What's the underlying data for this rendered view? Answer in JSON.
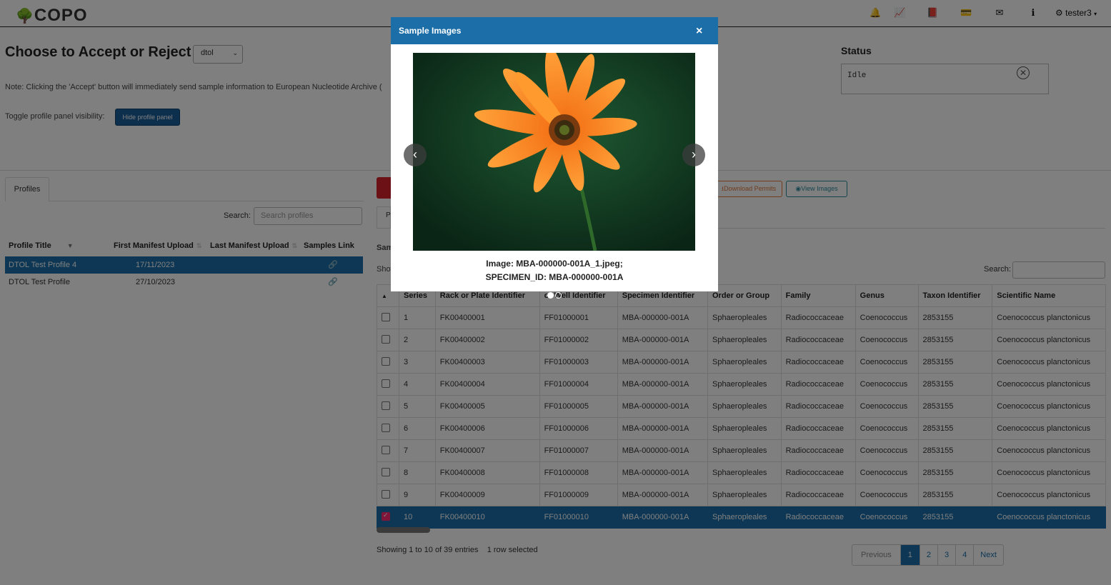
{
  "navbar": {
    "logo": "COPO",
    "icons": [
      "bell-icon",
      "chart-icon",
      "book-icon",
      "card-icon",
      "envelope-icon",
      "info-icon"
    ],
    "user": "tester3"
  },
  "header": {
    "title": "Choose to Accept or Reject",
    "group_select": "dtol",
    "note": "Note: Clicking the 'Accept' button will immediately send sample information to European Nucleotide Archive (",
    "toggle_label": "Toggle profile panel visibility:",
    "hide_button": "Hide profile panel"
  },
  "status": {
    "label": "Status",
    "value": "Idle"
  },
  "profiles": {
    "tab": "Profiles",
    "search_label": "Search:",
    "search_placeholder": "Search profiles",
    "columns": [
      "Profile Title",
      "First Manifest Upload",
      "Last Manifest Upload",
      "Samples Link"
    ],
    "rows": [
      {
        "title": "DTOL Test Profile 4",
        "first": "17/11/2023",
        "selected": true
      },
      {
        "title": "DTOL Test Profile",
        "first": "27/10/2023",
        "selected": false
      }
    ]
  },
  "samples": {
    "download_permits": "Download Permits",
    "view_images": "View Images",
    "tab_fragment": "P",
    "title_fragment": "Sam",
    "show_fragment": "Show",
    "search_label": "Search:",
    "columns": [
      "Series",
      "Rack or Plate Identifier",
      "or Well Identifier",
      "Specimen Identifier",
      "Order or Group",
      "Family",
      "Genus",
      "Taxon Identifier",
      "Scientific Name"
    ],
    "rows": [
      [
        "1",
        "FK00400001",
        "FF01000001",
        "MBA-000000-001A",
        "Sphaeropleales",
        "Radiococcaceae",
        "Coenococcus",
        "2853155",
        "Coenococcus planctonicus"
      ],
      [
        "2",
        "FK00400002",
        "FF01000002",
        "MBA-000000-001A",
        "Sphaeropleales",
        "Radiococcaceae",
        "Coenococcus",
        "2853155",
        "Coenococcus planctonicus"
      ],
      [
        "3",
        "FK00400003",
        "FF01000003",
        "MBA-000000-001A",
        "Sphaeropleales",
        "Radiococcaceae",
        "Coenococcus",
        "2853155",
        "Coenococcus planctonicus"
      ],
      [
        "4",
        "FK00400004",
        "FF01000004",
        "MBA-000000-001A",
        "Sphaeropleales",
        "Radiococcaceae",
        "Coenococcus",
        "2853155",
        "Coenococcus planctonicus"
      ],
      [
        "5",
        "FK00400005",
        "FF01000005",
        "MBA-000000-001A",
        "Sphaeropleales",
        "Radiococcaceae",
        "Coenococcus",
        "2853155",
        "Coenococcus planctonicus"
      ],
      [
        "6",
        "FK00400006",
        "FF01000006",
        "MBA-000000-001A",
        "Sphaeropleales",
        "Radiococcaceae",
        "Coenococcus",
        "2853155",
        "Coenococcus planctonicus"
      ],
      [
        "7",
        "FK00400007",
        "FF01000007",
        "MBA-000000-001A",
        "Sphaeropleales",
        "Radiococcaceae",
        "Coenococcus",
        "2853155",
        "Coenococcus planctonicus"
      ],
      [
        "8",
        "FK00400008",
        "FF01000008",
        "MBA-000000-001A",
        "Sphaeropleales",
        "Radiococcaceae",
        "Coenococcus",
        "2853155",
        "Coenococcus planctonicus"
      ],
      [
        "9",
        "FK00400009",
        "FF01000009",
        "MBA-000000-001A",
        "Sphaeropleales",
        "Radiococcaceae",
        "Coenococcus",
        "2853155",
        "Coenococcus planctonicus"
      ],
      [
        "10",
        "FK00400010",
        "FF01000010",
        "MBA-000000-001A",
        "Sphaeropleales",
        "Radiococcaceae",
        "Coenococcus",
        "2853155",
        "Coenococcus planctonicus"
      ]
    ],
    "selected_row": 9,
    "info": "Showing 1 to 10 of 39 entries",
    "selected_info": "1 row selected",
    "pagination": [
      "Previous",
      "1",
      "2",
      "3",
      "4",
      "Next"
    ]
  },
  "modal": {
    "title": "Sample Images",
    "close": "×",
    "caption_line1": "Image: MBA-000000-001A_1.jpeg;",
    "caption_line2": "SPECIMEN_ID: MBA-000000-001A",
    "prev": "‹",
    "next": "›"
  },
  "colors": {
    "primary": "#1b6ea8",
    "danger": "#d9232d",
    "selected_row": "#1b6ea8",
    "checkbox": "#ff2d75"
  }
}
